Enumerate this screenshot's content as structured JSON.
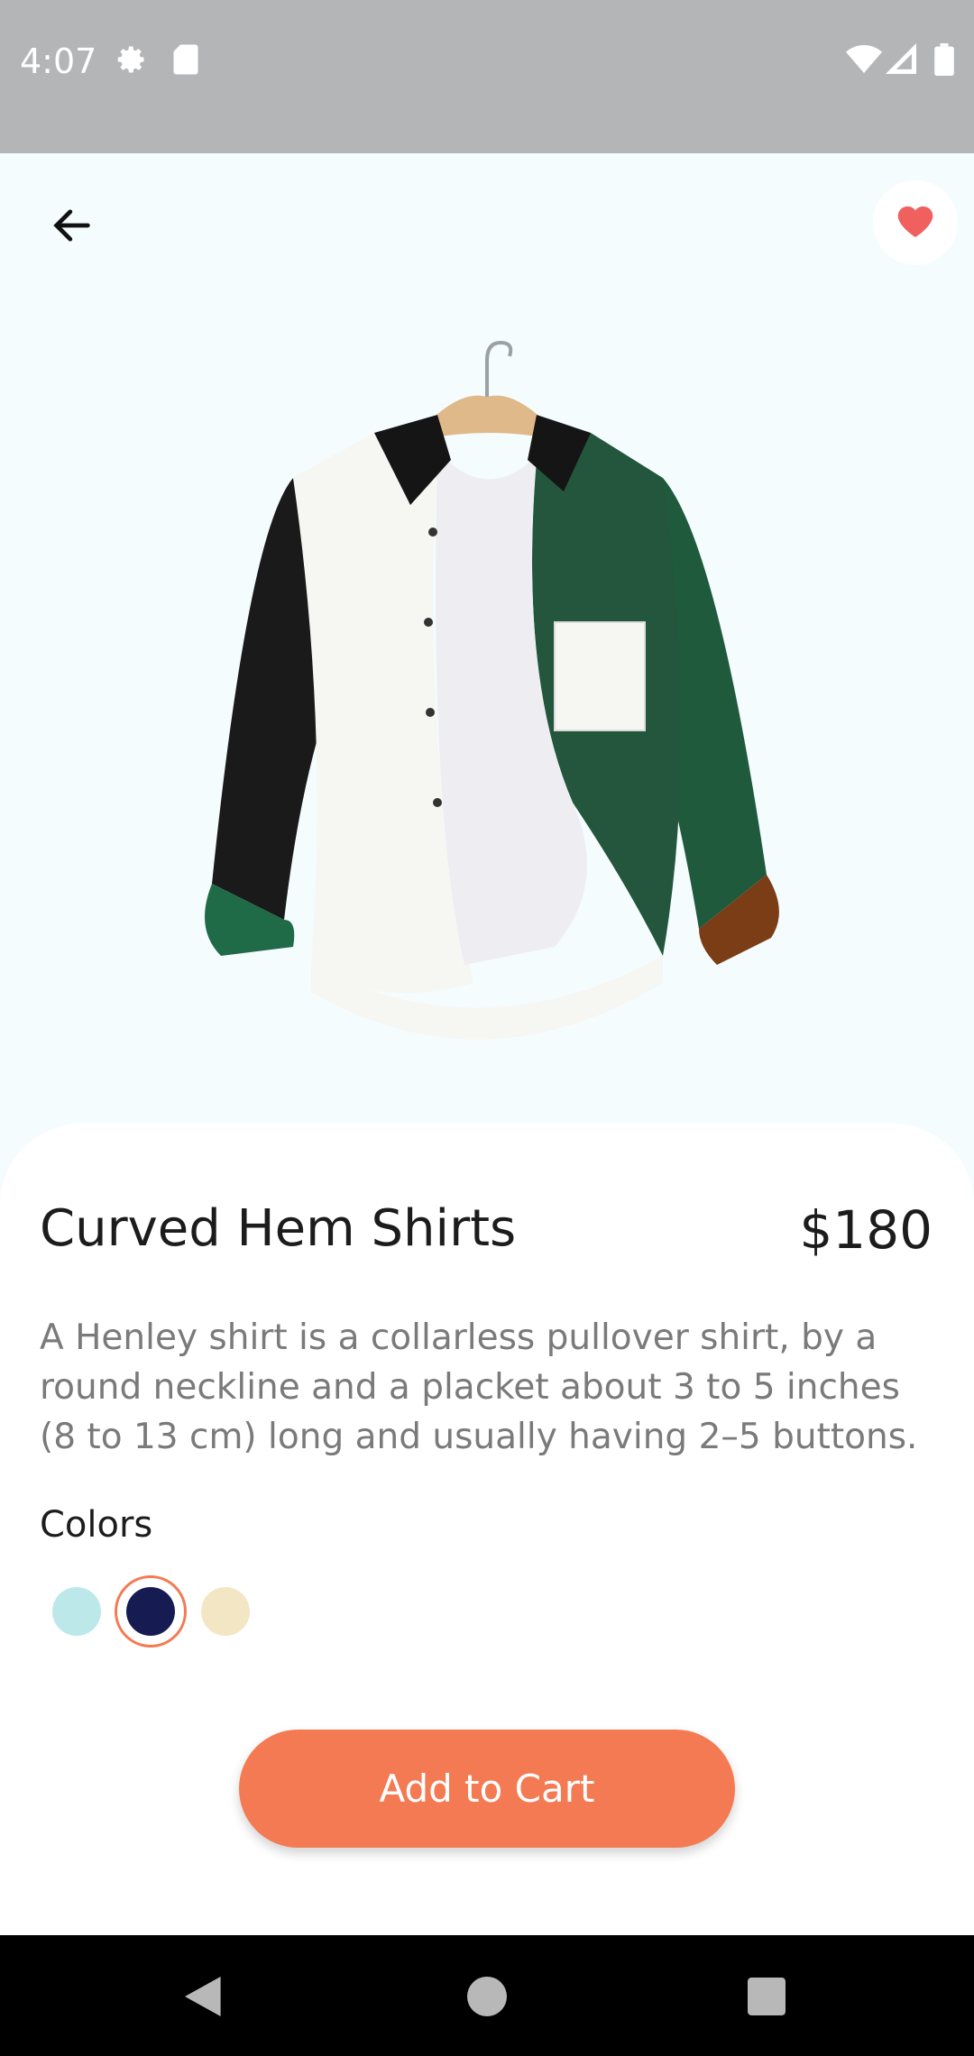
{
  "status_bar": {
    "time": "4:07",
    "icons": [
      "settings-icon",
      "sd-card-icon",
      "wifi-icon",
      "signal-icon",
      "battery-icon"
    ]
  },
  "header": {
    "back_icon": "arrow-left-icon",
    "favorite_icon": "heart-icon",
    "favorite_active": true
  },
  "product": {
    "title": "Curved Hem Shirts",
    "price": "$180",
    "description": "A Henley shirt is a collarless pullover shirt, by a round neckline and a placket about 3 to 5 inches (8 to 13 cm) long and usually having 2–5 buttons.",
    "image": "shirt-image"
  },
  "colors": {
    "label": "Colors",
    "options": [
      {
        "hex": "#bde8ea",
        "selected": false
      },
      {
        "hex": "#161c52",
        "selected": true
      },
      {
        "hex": "#f3e6c4",
        "selected": false
      }
    ]
  },
  "cta": {
    "label": "Add to Cart",
    "color": "#f47a53"
  },
  "nav_bar": {
    "icons": [
      "back-triangle-icon",
      "home-circle-icon",
      "recents-square-icon"
    ]
  },
  "theme": {
    "accent": "#f47a53",
    "heart": "#f0605f",
    "background": "#f5fcfd"
  }
}
